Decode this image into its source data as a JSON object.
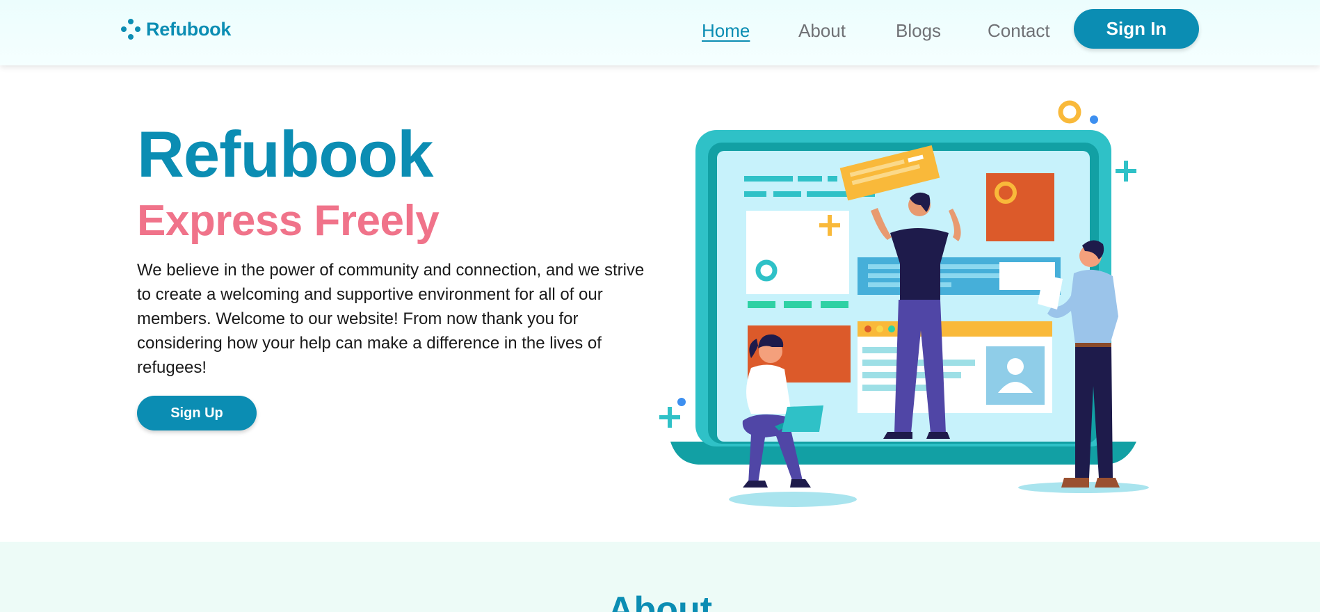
{
  "nav": {
    "brand": "Refubook",
    "links": [
      {
        "label": "Home",
        "active": true
      },
      {
        "label": "About",
        "active": false
      },
      {
        "label": "Blogs",
        "active": false
      },
      {
        "label": "Contact",
        "active": false
      }
    ],
    "signin_label": "Sign In"
  },
  "hero": {
    "title": "Refubook",
    "subtitle": "Express Freely",
    "description": "We believe in the power of community and connection, and we strive to create a welcoming and supportive environment for all of our members. Welcome to our website! From now thank you for considering how your help can make a difference in the lives of refugees!",
    "signup_label": "Sign Up"
  },
  "about": {
    "heading": "About"
  },
  "colors": {
    "primary": "#0b8db3",
    "accent_pink": "#f0738a",
    "about_bg": "#edfbf7"
  }
}
